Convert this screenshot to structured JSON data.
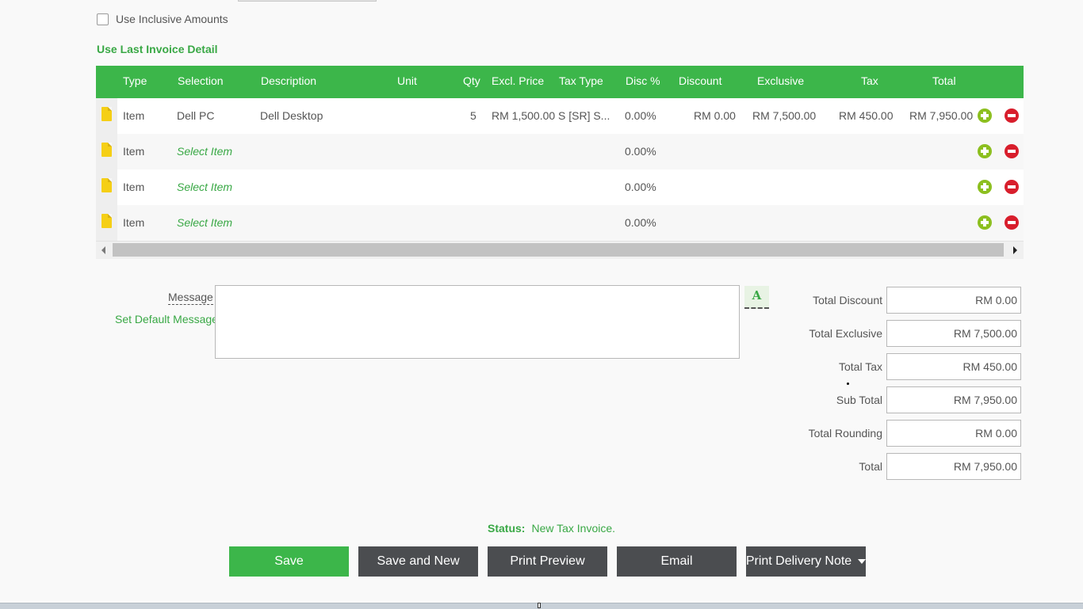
{
  "options": {
    "inclusive_label": "Use Inclusive Amounts",
    "last_invoice_link": "Use Last Invoice Detail"
  },
  "grid": {
    "columns": [
      "Type",
      "Selection",
      "Description",
      "Unit",
      "Qty",
      "Excl. Price",
      "Tax Type",
      "Disc %",
      "Discount",
      "Exclusive",
      "Tax",
      "Total"
    ],
    "rows": [
      {
        "type": "Item",
        "selection": "Dell PC",
        "description": "Dell Desktop",
        "unit": "",
        "qty": "5",
        "excl_price": "RM 1,500.00",
        "tax_type": "S [SR] S...",
        "disc_pct": "0.00%",
        "discount": "RM 0.00",
        "exclusive": "RM 7,500.00",
        "tax": "RM 450.00",
        "total": "RM 7,950.00"
      },
      {
        "type": "Item",
        "selection": "Select Item",
        "description": "",
        "unit": "",
        "qty": "",
        "excl_price": "",
        "tax_type": "",
        "disc_pct": "0.00%",
        "discount": "",
        "exclusive": "",
        "tax": "",
        "total": ""
      },
      {
        "type": "Item",
        "selection": "Select Item",
        "description": "",
        "unit": "",
        "qty": "",
        "excl_price": "",
        "tax_type": "",
        "disc_pct": "0.00%",
        "discount": "",
        "exclusive": "",
        "tax": "",
        "total": ""
      },
      {
        "type": "Item",
        "selection": "Select Item",
        "description": "",
        "unit": "",
        "qty": "",
        "excl_price": "",
        "tax_type": "",
        "disc_pct": "0.00%",
        "discount": "",
        "exclusive": "",
        "tax": "",
        "total": ""
      }
    ]
  },
  "message": {
    "label": "Message",
    "set_default": "Set Default Message",
    "value": "",
    "font_button": "A"
  },
  "totals": {
    "discount_label": "Total Discount",
    "discount": "RM 0.00",
    "exclusive_label": "Total Exclusive",
    "exclusive": "RM 7,500.00",
    "tax_label": "Total Tax",
    "tax": "RM 450.00",
    "subtotal_label": "Sub Total",
    "subtotal": "RM 7,950.00",
    "rounding_label": "Total Rounding",
    "rounding": "RM 0.00",
    "total_label": "Total",
    "total": "RM 7,950.00"
  },
  "status": {
    "label": "Status:",
    "value": "New Tax Invoice."
  },
  "buttons": {
    "save": "Save",
    "save_new": "Save and New",
    "print_preview": "Print Preview",
    "email": "Email",
    "print_delivery": "Print Delivery Note"
  },
  "colors": {
    "accent": "#3cb64a",
    "dark_button": "#4b4d50",
    "delete": "#d81e2c",
    "add": "#8cbf1f",
    "doc_icon": "#f5cf16"
  },
  "icons": [
    "document-icon",
    "add-circle-icon",
    "remove-circle-icon",
    "caret-down-icon",
    "font-icon"
  ]
}
